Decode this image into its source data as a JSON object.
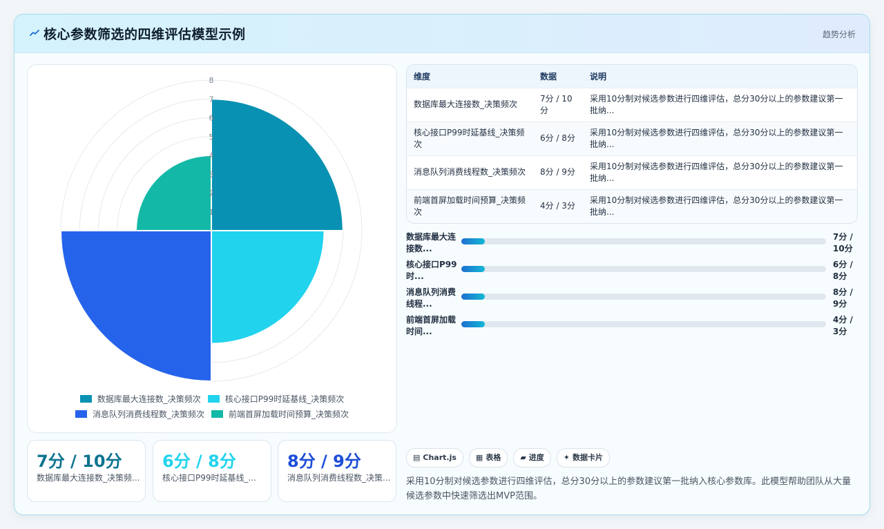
{
  "header": {
    "icon": "trend-line-icon",
    "title": "核心参数筛选的四维评估模型示例",
    "action_label": "趋势分析"
  },
  "chart_data": {
    "type": "polar-area",
    "categories": [
      "数据库最大连接数_决策频次",
      "核心接口P99时延基线_决策频次",
      "消息队列消费线程数_决策频次",
      "前端首屏加载时间预算_决策频次"
    ],
    "values": [
      7,
      6,
      8,
      4
    ],
    "colors": [
      "#0891b2",
      "#22d3ee",
      "#2563eb",
      "#14b8a6"
    ],
    "rlim": [
      0,
      8
    ],
    "radial_ticks": [
      "0",
      "1",
      "2",
      "3",
      "4",
      "5",
      "6",
      "7",
      "8"
    ],
    "legend_position": "bottom",
    "grid": true
  },
  "table": {
    "headers": [
      "维度",
      "数据",
      "说明"
    ],
    "rows": [
      {
        "dimension": "数据库最大连接数_决策频次",
        "data": "7分 / 10分",
        "note": "采用10分制对候选参数进行四维评估，总分30分以上的参数建议第一批纳..."
      },
      {
        "dimension": "核心接口P99时延基线_决策频次",
        "data": "6分 / 8分",
        "note": "采用10分制对候选参数进行四维评估，总分30分以上的参数建议第一批纳..."
      },
      {
        "dimension": "消息队列消费线程数_决策频次",
        "data": "8分 / 9分",
        "note": "采用10分制对候选参数进行四维评估，总分30分以上的参数建议第一批纳..."
      },
      {
        "dimension": "前端首屏加载时间预算_决策频次",
        "data": "4分 / 3分",
        "note": "采用10分制对候选参数进行四维评估，总分30分以上的参数建议第一批纳..."
      }
    ]
  },
  "progress": [
    {
      "label": "数据库最大连接数...",
      "value_text": "7分 / 10分",
      "fraction": 0.065
    },
    {
      "label": "核心接口P99时...",
      "value_text": "6分 / 8分",
      "fraction": 0.065
    },
    {
      "label": "消息队列消费线程...",
      "value_text": "8分 / 9分",
      "fraction": 0.065
    },
    {
      "label": "前端首屏加载时间...",
      "value_text": "4分 / 3分",
      "fraction": 0.065
    }
  ],
  "stats": [
    {
      "value": "7分 / 10分",
      "label": "数据库最大连接数_决策频...",
      "color": "#0e7490"
    },
    {
      "value": "6分 / 8分",
      "label": "核心接口P99时延基线_...",
      "color": "#22d3ee"
    },
    {
      "value": "8分 / 9分",
      "label": "消息队列消费线程数_决策...",
      "color": "#1d4ed8"
    }
  ],
  "tags": [
    {
      "icon": "chart-icon",
      "glyph": "▤",
      "label": "Chart.js"
    },
    {
      "icon": "table-icon",
      "glyph": "▦",
      "label": "表格"
    },
    {
      "icon": "progress-icon",
      "glyph": "▰",
      "label": "进度"
    },
    {
      "icon": "sparkle-icon",
      "glyph": "✦",
      "label": "数据卡片"
    }
  ],
  "description": "采用10分制对候选参数进行四维评估，总分30分以上的参数建议第一批纳入核心参数库。此模型帮助团队从大量候选参数中快速筛选出MVP范围。"
}
